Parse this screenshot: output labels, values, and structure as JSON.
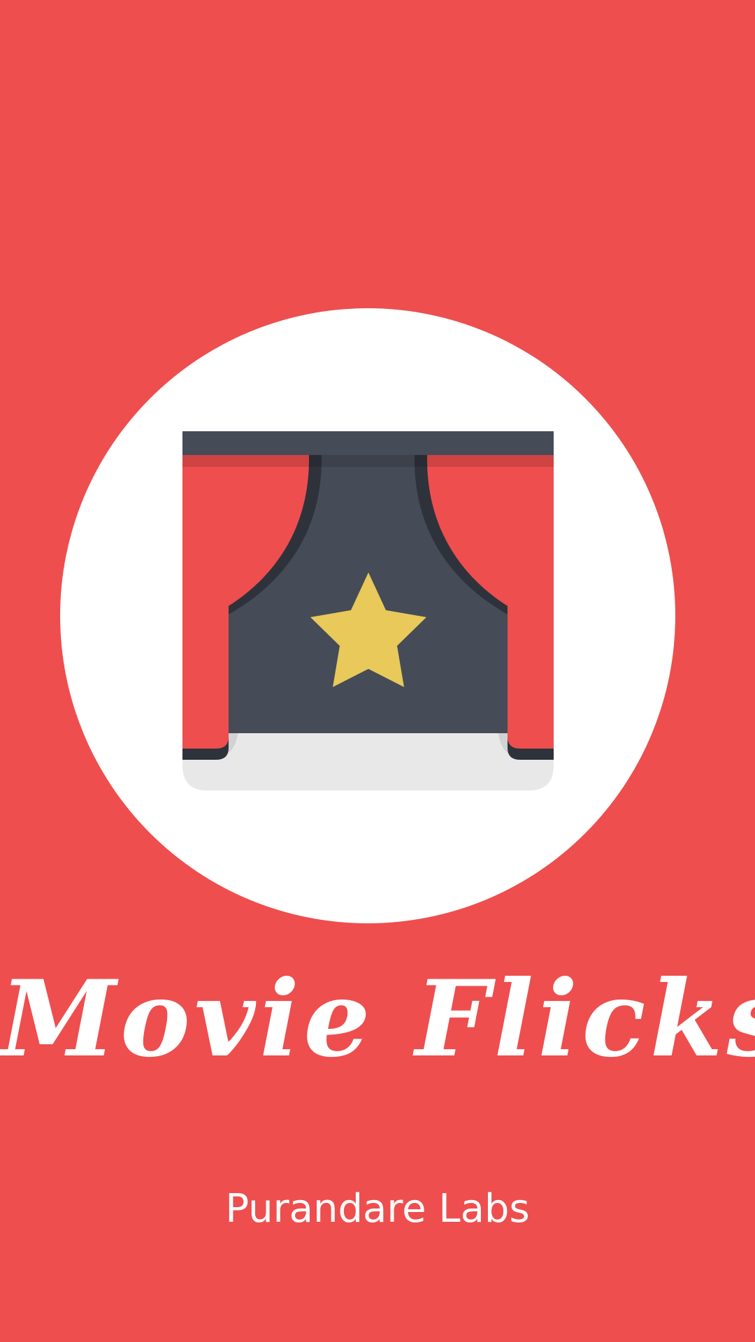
{
  "app": {
    "title": "Movie Flicks",
    "developer": "Purandare Labs"
  },
  "icons": {
    "logo": "theater-curtain-star-icon"
  },
  "colors": {
    "background": "#EE4E4E",
    "circle": "#FFFFFF",
    "curtain_red": "#EE4E4E",
    "stage_dark": "#454B57",
    "stage_outline": "#2E323B",
    "star": "#E8C95A",
    "floor": "#E8E8E8",
    "text": "#FFFFFF"
  }
}
